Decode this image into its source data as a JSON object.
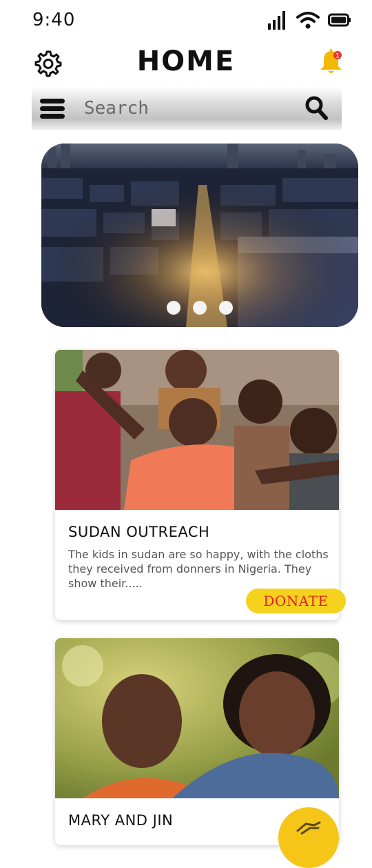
{
  "status_bar": {
    "time": "9:40"
  },
  "header": {
    "title": "HOME",
    "notification_count": "1"
  },
  "search": {
    "placeholder": "Search"
  },
  "carousel": {
    "slide_count": 3
  },
  "cards": [
    {
      "title": "SUDAN OUTREACH",
      "description": "The kids in sudan are so happy, with the cloths they received from donners in Nigeria. They show their.....",
      "button_label": "DONATE"
    },
    {
      "title": "MARY AND JIN"
    }
  ],
  "colors": {
    "accent_yellow": "#f5d21e",
    "donate_text": "#e02020",
    "bell": "#f5b800",
    "badge": "#e53935"
  }
}
